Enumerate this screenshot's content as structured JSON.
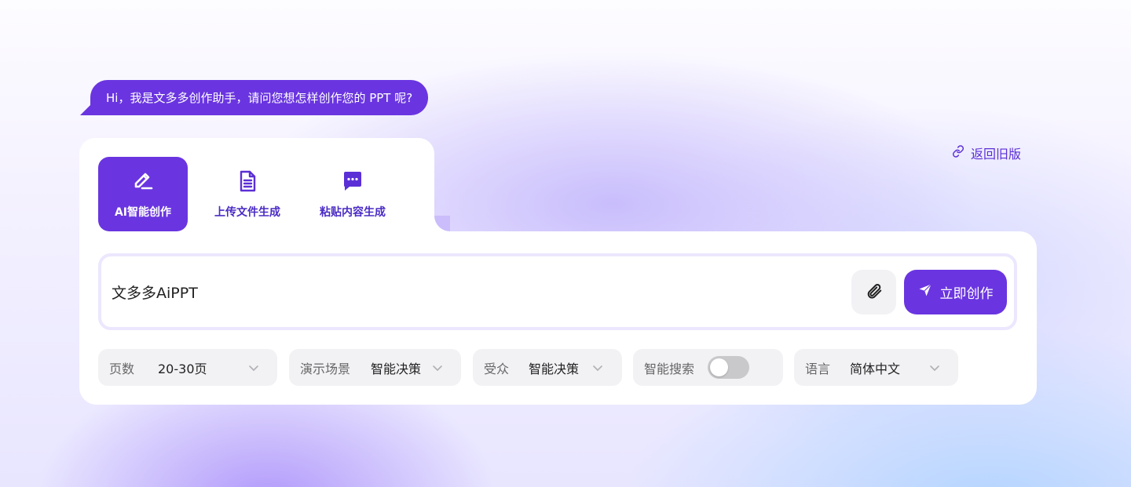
{
  "greeting": "Hi，我是文多多创作助手，请问您想怎样创作您的 PPT 呢?",
  "return_link": {
    "label": "返回旧版",
    "icon": "link-icon"
  },
  "tabs": [
    {
      "label": "AI智能创作",
      "icon": "pen-icon",
      "active": true
    },
    {
      "label": "上传文件生成",
      "icon": "document-icon",
      "active": false
    },
    {
      "label": "粘贴内容生成",
      "icon": "chat-bubble-icon",
      "active": false
    }
  ],
  "input": {
    "value": "文多多AiPPT"
  },
  "attach_icon": "paperclip-icon",
  "create_button": {
    "label": "立即创作",
    "icon": "send-icon"
  },
  "options": {
    "pages": {
      "label": "页数",
      "value": "20-30页"
    },
    "scene": {
      "label": "演示场景",
      "value": "智能决策"
    },
    "audience": {
      "label": "受众",
      "value": "智能决策"
    },
    "search": {
      "label": "智能搜索",
      "enabled": false
    },
    "language": {
      "label": "语言",
      "value": "简体中文"
    }
  },
  "colors": {
    "accent": "#6a35e0",
    "pill_bg": "#f2f2f5",
    "toggle_off": "#c9c9cc"
  }
}
